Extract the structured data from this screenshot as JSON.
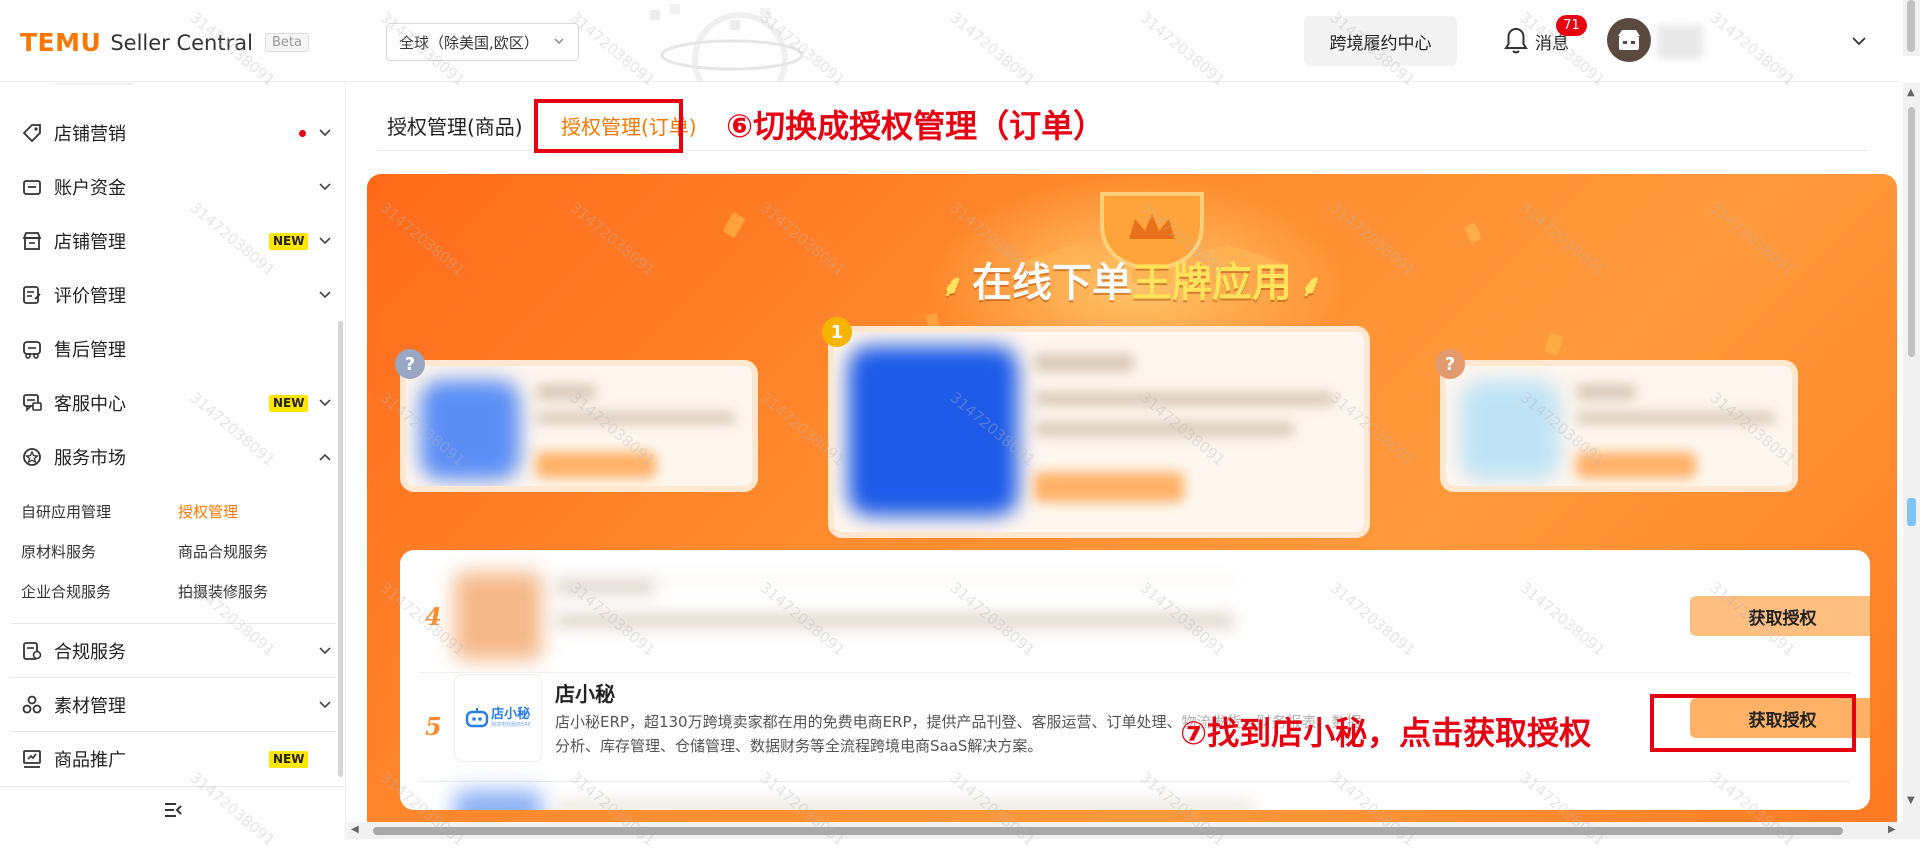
{
  "header": {
    "logo_brand": "TEMU",
    "logo_product": "Seller Central",
    "logo_badge": "Beta",
    "region_value": "全球（除美国,欧区）",
    "fulfillment_button": "跨境履约中心",
    "messages_label": "消息",
    "messages_count": "71"
  },
  "sidebar": {
    "items": [
      {
        "label": "店铺营销",
        "icon": "tag-icon",
        "has_dot": true
      },
      {
        "label": "账户资金",
        "icon": "wallet-icon"
      },
      {
        "label": "店铺管理",
        "icon": "store-icon",
        "badge": "NEW"
      },
      {
        "label": "评价管理",
        "icon": "review-icon"
      },
      {
        "label": "售后管理",
        "icon": "after-sales-icon"
      },
      {
        "label": "客服中心",
        "icon": "customer-service-icon",
        "badge": "NEW"
      },
      {
        "label": "服务市场",
        "icon": "service-market-icon",
        "expanded": true
      },
      {
        "label": "合规服务",
        "icon": "compliance-icon"
      },
      {
        "label": "素材管理",
        "icon": "material-icon"
      },
      {
        "label": "商品推广",
        "icon": "promotion-icon",
        "badge": "NEW"
      }
    ],
    "sub_items": [
      {
        "label": "自研应用管理"
      },
      {
        "label": "授权管理",
        "active": true
      },
      {
        "label": "原材料服务"
      },
      {
        "label": "商品合规服务"
      },
      {
        "label": "企业合规服务"
      },
      {
        "label": "拍摄装修服务"
      }
    ]
  },
  "tabs": {
    "goods": "授权管理(商品)",
    "orders": "授权管理(订单)"
  },
  "annotations": {
    "step6": "⑥切换成授权管理（订单）",
    "step7": "⑦找到店小秘，点击获取授权"
  },
  "banner": {
    "title_part1": "在线下单",
    "title_part2": "王牌应用",
    "laurel": "⸙"
  },
  "podium": [
    {
      "medal": "?",
      "medal_color": "#9aa7c4"
    },
    {
      "medal": "1",
      "medal_color": "#f5b400"
    },
    {
      "medal": "?",
      "medal_color": "#e39a6c"
    }
  ],
  "list": {
    "rows": [
      {
        "rank": "4",
        "button": "获取授权"
      },
      {
        "rank": "5",
        "name": "店小秘",
        "logo_text": "店小秘",
        "logo_subtext": "跨境电商服务ERP",
        "description": "店小秘ERP，超130万跨境卖家都在用的免费电商ERP，提供产品刊登、客服运营、订单处理、物流发货、财务报表、数据分析、库存管理、仓储管理、数据财务等全流程跨境电商SaaS解决方案。",
        "button": "获取授权"
      }
    ]
  },
  "colors": {
    "brand_orange": "#fb7701",
    "annotation_red": "#e60012",
    "new_badge": "#ffe600",
    "button_orange": "#ffb266"
  },
  "watermark_text": "31472038091"
}
